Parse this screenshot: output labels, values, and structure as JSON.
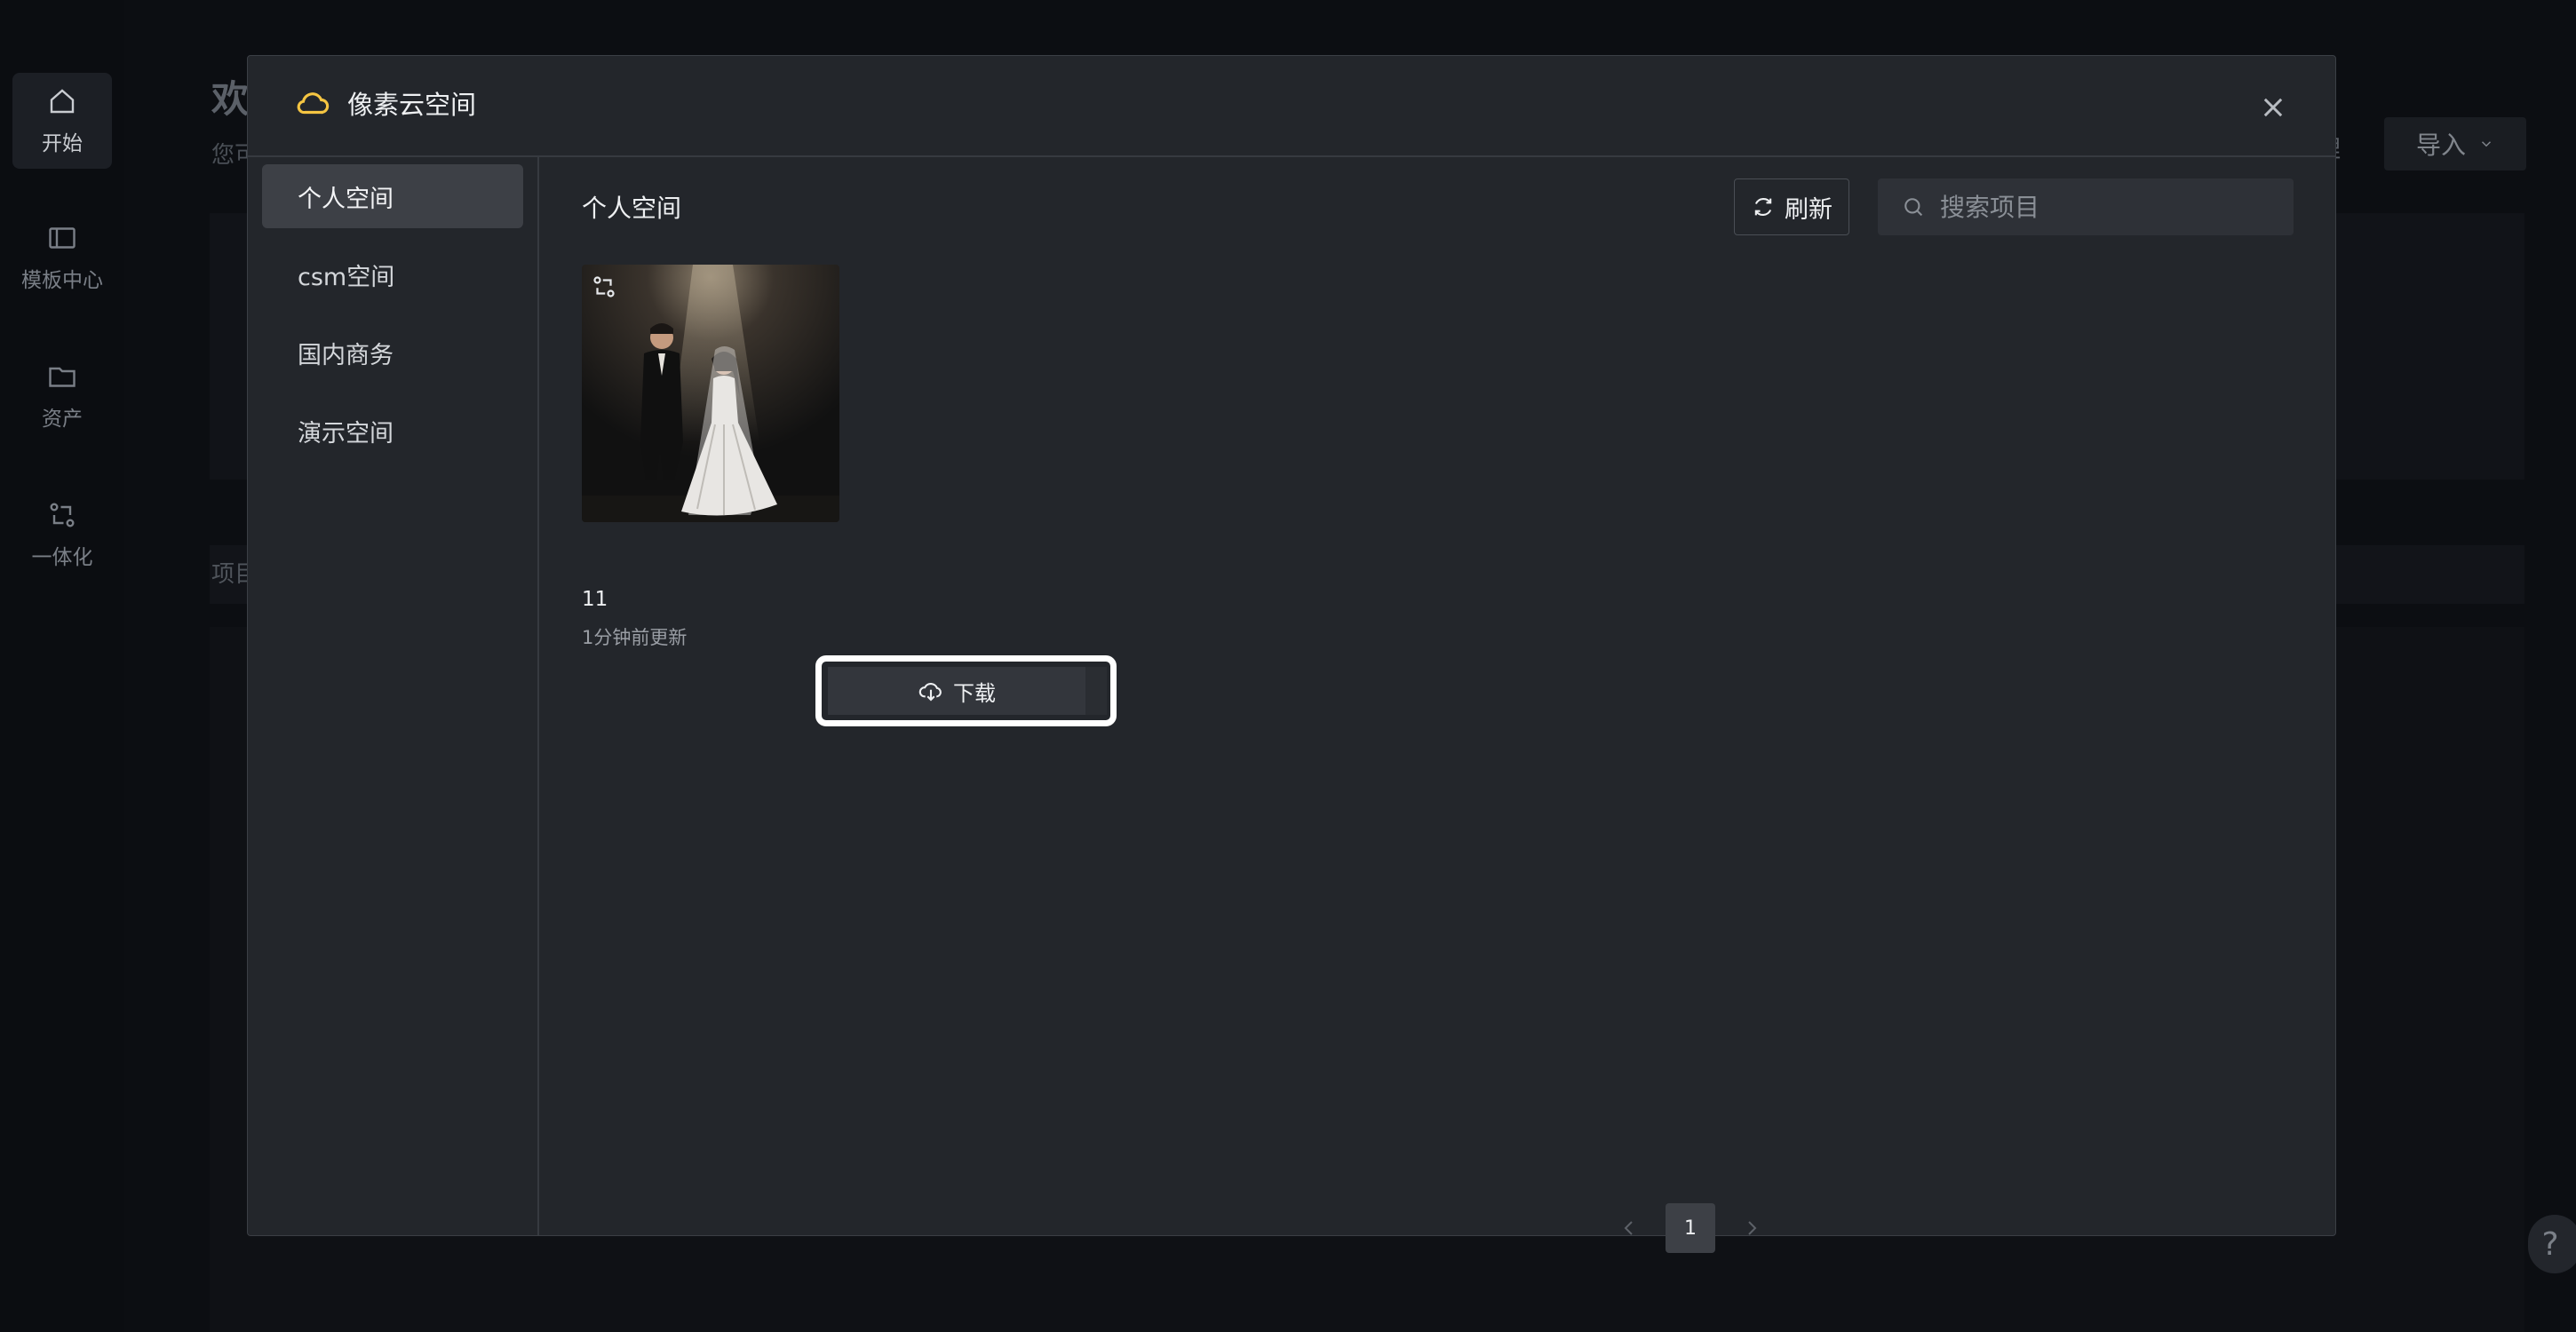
{
  "rail": {
    "items": [
      {
        "label": "开始",
        "icon": "home-icon",
        "active": true
      },
      {
        "label": "模板中心",
        "icon": "template-icon",
        "active": false
      },
      {
        "label": "资产",
        "icon": "folder-icon",
        "active": false
      },
      {
        "label": "一体化",
        "icon": "integration-icon",
        "active": false
      }
    ]
  },
  "background": {
    "title": "欢",
    "subtitle": "您可",
    "section": "项目",
    "manage": "理",
    "import_label": "导入",
    "help": "?"
  },
  "modal": {
    "title": "像素云空间",
    "title_icon": "cloud-icon",
    "sidebar": [
      {
        "label": "个人空间",
        "active": true
      },
      {
        "label": "csm空间",
        "active": false
      },
      {
        "label": "国内商务",
        "active": false
      },
      {
        "label": "演示空间",
        "active": false
      }
    ],
    "content_title": "个人空间",
    "refresh_label": "刷新",
    "search_placeholder": "搜索项目",
    "project": {
      "name": "11",
      "updated": "1分钟前更新",
      "download_label": "下载"
    },
    "pagination": {
      "current": "1"
    }
  },
  "colors": {
    "accent_cloud": "#f5c542",
    "modal_bg": "#23262b",
    "page_bg": "#0e1014"
  }
}
